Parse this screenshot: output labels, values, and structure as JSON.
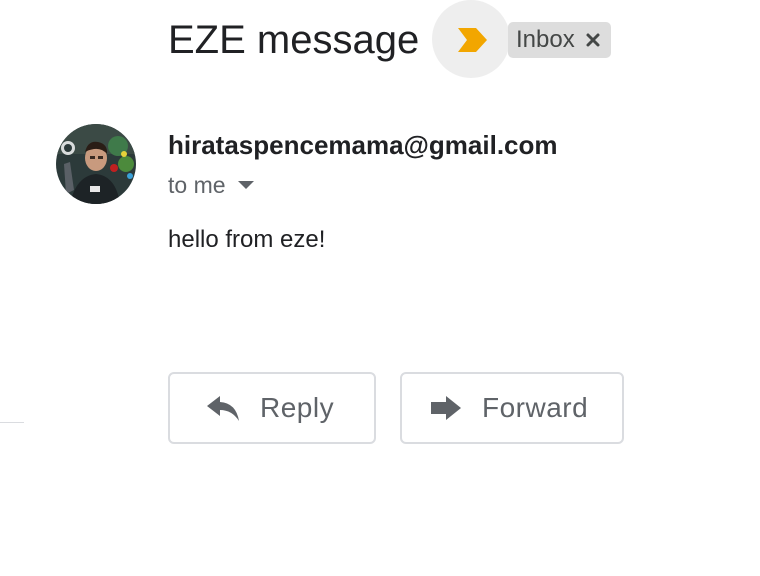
{
  "email": {
    "subject": "EZE message",
    "label": "Inbox",
    "sender": "hirataspencemama@gmail.com",
    "recipient_label": "to me",
    "body": "hello from eze!"
  },
  "actions": {
    "reply_label": "Reply",
    "forward_label": "Forward"
  },
  "icons": {
    "importance": "importance-marker-icon",
    "label_close": "close-icon",
    "recipient_dropdown": "caret-down-icon",
    "reply": "reply-arrow-icon",
    "forward": "forward-arrow-icon"
  },
  "colors": {
    "importance_marker": "#f2a600",
    "chip_background": "#dddddd",
    "button_border": "#dadce0",
    "secondary_text": "#5f6368",
    "primary_text": "#202124"
  }
}
